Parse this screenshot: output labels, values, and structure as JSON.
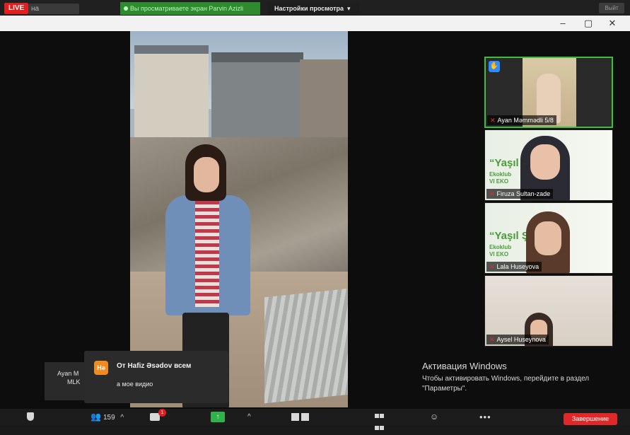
{
  "top_bar": {
    "live_label": "LIVE",
    "live_target": "на Facebook",
    "share_status": "Вы просматриваете экран Parvin Azizli",
    "view_settings": "Настройки просмотра",
    "right_button": "Выйт"
  },
  "window": {
    "minimize": "–",
    "maximize": "▢",
    "close": "✕"
  },
  "participants": [
    {
      "name": "Ayan Məmmədli 5/8",
      "raised_hand": true,
      "muted": true
    },
    {
      "name": "Firuza Sultan-zade",
      "muted": true,
      "banner": "“Yaşıl Ş",
      "banner_sub": "Ekoklub\nVI EKO"
    },
    {
      "name": "Lala Huseyova",
      "muted": true,
      "banner": "“Yaşıl Ş",
      "banner_sub": "Ekoklub\nVI EKO"
    },
    {
      "name": "Aysel Huseynova",
      "muted": true
    }
  ],
  "chat_hidden": {
    "line1": "Ayan M",
    "line2": "MLK"
  },
  "chat_toast": {
    "avatar_initials": "Hə",
    "from": "От Hafiz Əsədov всем",
    "message": "а мое видио"
  },
  "activation": {
    "title": "Активация Windows",
    "text": "Чтобы активировать Windows, перейдите в раздел \"Параметры\"."
  },
  "toolbar": {
    "participants_count": "159",
    "chat_badge": "1",
    "share_arrow": "↑",
    "caret": "^",
    "more": "•••",
    "end_label": "Завершение"
  },
  "colors": {
    "live_red": "#e02020",
    "share_green": "#2e8b2e",
    "active_speaker_border": "#3cbf3c",
    "raise_hand_blue": "#2d8cff",
    "end_red": "#e02828"
  },
  "icons": [
    "shield-icon",
    "participants-icon",
    "chat-icon",
    "share-screen-icon",
    "record-icon",
    "gallery-icon",
    "reaction-icon",
    "more-icon",
    "raise-hand-icon",
    "mic-muted-icon"
  ]
}
